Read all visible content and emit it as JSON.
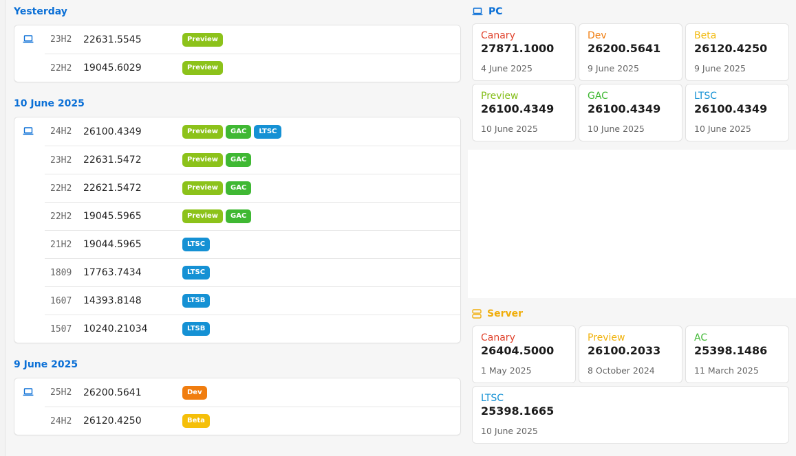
{
  "groups": [
    {
      "heading": "Yesterday",
      "rows": [
        {
          "version": "23H2",
          "build": "22631.5545",
          "badges": [
            {
              "label": "Preview",
              "kind": "preview"
            }
          ]
        },
        {
          "version": "22H2",
          "build": "19045.6029",
          "badges": [
            {
              "label": "Preview",
              "kind": "preview"
            }
          ]
        }
      ]
    },
    {
      "heading": "10 June 2025",
      "rows": [
        {
          "version": "24H2",
          "build": "26100.4349",
          "badges": [
            {
              "label": "Preview",
              "kind": "preview"
            },
            {
              "label": "GAC",
              "kind": "gac"
            },
            {
              "label": "LTSC",
              "kind": "ltsc"
            }
          ]
        },
        {
          "version": "23H2",
          "build": "22631.5472",
          "badges": [
            {
              "label": "Preview",
              "kind": "preview"
            },
            {
              "label": "GAC",
              "kind": "gac"
            }
          ]
        },
        {
          "version": "22H2",
          "build": "22621.5472",
          "badges": [
            {
              "label": "Preview",
              "kind": "preview"
            },
            {
              "label": "GAC",
              "kind": "gac"
            }
          ]
        },
        {
          "version": "22H2",
          "build": "19045.5965",
          "badges": [
            {
              "label": "Preview",
              "kind": "preview"
            },
            {
              "label": "GAC",
              "kind": "gac"
            }
          ]
        },
        {
          "version": "21H2",
          "build": "19044.5965",
          "badges": [
            {
              "label": "LTSC",
              "kind": "ltsc"
            }
          ]
        },
        {
          "version": "1809",
          "build": "17763.7434",
          "badges": [
            {
              "label": "LTSC",
              "kind": "ltsc"
            }
          ]
        },
        {
          "version": "1607",
          "build": "14393.8148",
          "badges": [
            {
              "label": "LTSB",
              "kind": "ltsb"
            }
          ]
        },
        {
          "version": "1507",
          "build": "10240.21034",
          "badges": [
            {
              "label": "LTSB",
              "kind": "ltsb"
            }
          ]
        }
      ]
    },
    {
      "heading": "9 June 2025",
      "rows": [
        {
          "version": "25H2",
          "build": "26200.5641",
          "badges": [
            {
              "label": "Dev",
              "kind": "dev"
            }
          ]
        },
        {
          "version": "24H2",
          "build": "26120.4250",
          "badges": [
            {
              "label": "Beta",
              "kind": "beta"
            }
          ]
        }
      ]
    }
  ],
  "pc": {
    "heading": "PC",
    "icon": "laptop-icon",
    "tiles": [
      {
        "channel": "Canary",
        "build": "27871.1000",
        "date": "4 June 2025",
        "color": "#e0432d"
      },
      {
        "channel": "Dev",
        "build": "26200.5641",
        "date": "9 June 2025",
        "color": "#f07d0f"
      },
      {
        "channel": "Beta",
        "build": "26120.4250",
        "date": "9 June 2025",
        "color": "#f2b90c"
      },
      {
        "channel": "Preview",
        "build": "26100.4349",
        "date": "10 June 2025",
        "color": "#83bd17"
      },
      {
        "channel": "GAC",
        "build": "26100.4349",
        "date": "10 June 2025",
        "color": "#3fb833"
      },
      {
        "channel": "LTSC",
        "build": "26100.4349",
        "date": "10 June 2025",
        "color": "#1591d4"
      }
    ]
  },
  "server": {
    "heading": "Server",
    "icon": "server-icon",
    "tiles": [
      {
        "channel": "Canary",
        "build": "26404.5000",
        "date": "1 May 2025",
        "color": "#e0432d"
      },
      {
        "channel": "Preview",
        "build": "26100.2033",
        "date": "8 October 2024",
        "color": "#f0b20c"
      },
      {
        "channel": "AC",
        "build": "25398.1486",
        "date": "11 March 2025",
        "color": "#3fb833"
      },
      {
        "channel": "LTSC",
        "build": "25398.1665",
        "date": "10 June 2025",
        "color": "#1591d4"
      }
    ]
  },
  "colors": {
    "accent": "#0a6fd6",
    "preview": "#8cc21a",
    "gac": "#3fb833",
    "ltsc": "#1591d4",
    "dev": "#f07d0f",
    "beta": "#f5bf09",
    "server": "#f0ae0c"
  }
}
